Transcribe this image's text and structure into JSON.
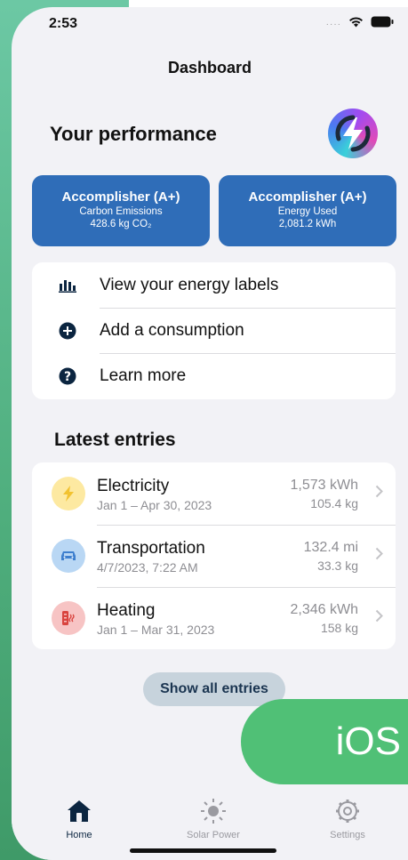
{
  "status_bar": {
    "time": "2:53"
  },
  "header": {
    "title": "Dashboard"
  },
  "performance": {
    "title": "Your performance",
    "cards": [
      {
        "title": "Accomplisher (A+)",
        "subtitle": "Carbon Emissions",
        "value": "428.6 kg CO₂"
      },
      {
        "title": "Accomplisher (A+)",
        "subtitle": "Energy Used",
        "value": "2,081.2 kWh"
      }
    ]
  },
  "menu": {
    "items": [
      {
        "label": "View your energy labels",
        "icon": "bar-chart-icon"
      },
      {
        "label": "Add a consumption",
        "icon": "plus-circle-icon"
      },
      {
        "label": "Learn more",
        "icon": "question-circle-icon"
      }
    ]
  },
  "latest": {
    "title": "Latest entries",
    "entries": [
      {
        "name": "Electricity",
        "date": "Jan 1 – Apr 30, 2023",
        "value1": "1,573 kWh",
        "value2": "105.4 kg",
        "icon": "lightning-icon",
        "color": "#fde9a1"
      },
      {
        "name": "Transportation",
        "date": "4/7/2023, 7:22 AM",
        "value1": "132.4 mi",
        "value2": "33.3 kg",
        "icon": "car-icon",
        "color": "#b9d7f4"
      },
      {
        "name": "Heating",
        "date": "Jan 1 – Mar 31, 2023",
        "value1": "2,346 kWh",
        "value2": "158 kg",
        "icon": "heater-icon",
        "color": "#f7c4c4"
      }
    ],
    "show_all_label": "Show all entries"
  },
  "badge": {
    "label": "iOS"
  },
  "tabs": [
    {
      "label": "Home",
      "icon": "house-icon",
      "active": true
    },
    {
      "label": "Solar Power",
      "icon": "sun-icon",
      "active": false
    },
    {
      "label": "Settings",
      "icon": "gear-icon",
      "active": false
    }
  ],
  "colors": {
    "accent": "#2f6db8",
    "background": "#f2f2f6",
    "green": "#50c076"
  }
}
